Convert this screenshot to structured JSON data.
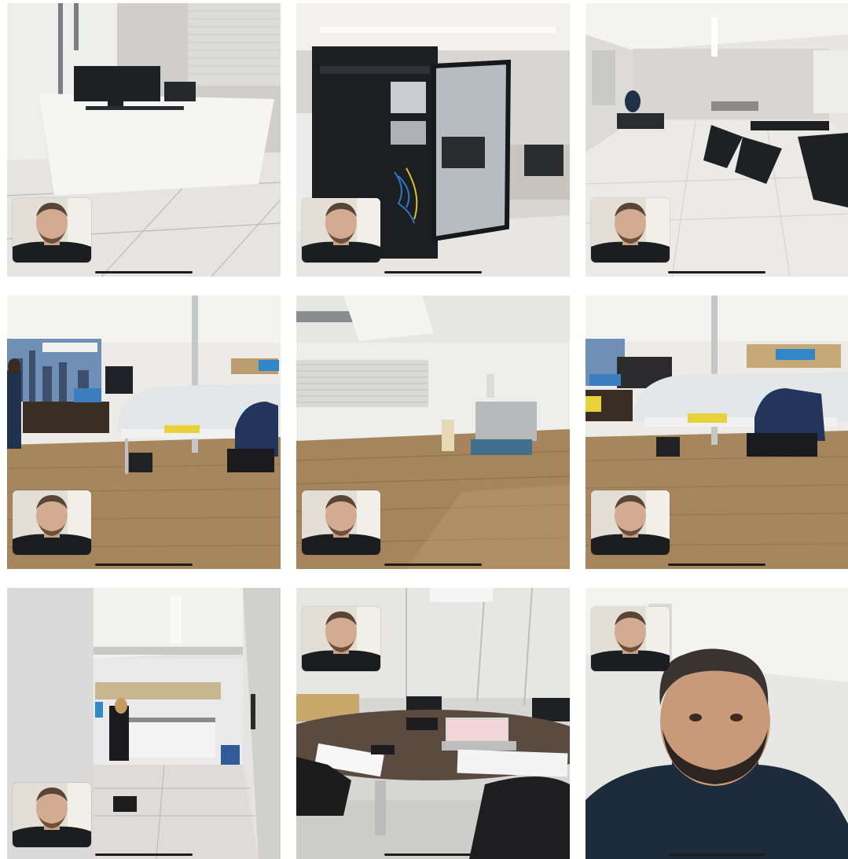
{
  "grid": {
    "tiles": [
      {
        "scene": "desk-icon",
        "pip": "top-left-offset",
        "theme": "#dedbd6"
      },
      {
        "scene": "server-rack-icon",
        "pip": "bottom-left",
        "theme": "#d6d2cc"
      },
      {
        "scene": "corridor-icon",
        "pip": "bottom-left",
        "theme": "#e3e1dd"
      },
      {
        "scene": "office-cubicles-icon",
        "pip": "bottom-left",
        "theme": "#b9a07c"
      },
      {
        "scene": "empty-room-icon",
        "pip": "bottom-left",
        "theme": "#a6855d"
      },
      {
        "scene": "office-cubicles-icon",
        "pip": "bottom-left",
        "theme": "#b9a07c"
      },
      {
        "scene": "hallway-kitchen-icon",
        "pip": "bottom-left",
        "theme": "#d9d9d9"
      },
      {
        "scene": "meeting-table-icon",
        "pip": "top-left",
        "theme": "#cfcfcf"
      },
      {
        "scene": "person-closeup-icon",
        "pip": "top-left",
        "theme": "#e5e5e3"
      }
    ]
  },
  "colors": {
    "floor_wood": "#a7865d",
    "floor_tile": "#e4e2de",
    "wall": "#e9e8e5",
    "dark_furniture": "#1f2226",
    "sweater": "#1d2b3a"
  }
}
